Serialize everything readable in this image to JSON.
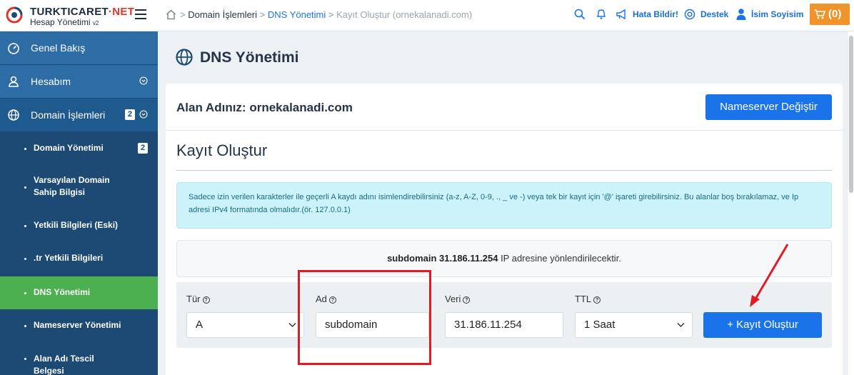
{
  "brand": {
    "name_main": "TURKTICARET",
    "name_accent": "·NET",
    "subtitle": "Hesap Yönetimi",
    "version": "v2"
  },
  "sidebar": {
    "main_items": [
      {
        "label": "Genel Bakış",
        "icon": "dashboard-icon"
      },
      {
        "label": "Hesabım",
        "icon": "user-icon"
      },
      {
        "label": "Domain İşlemleri",
        "icon": "globe-icon",
        "badge": "2"
      }
    ],
    "sub_items": [
      {
        "label": "Domain Yönetimi",
        "badge": "2"
      },
      {
        "label": "Varsayılan Domain Sahip Bilgisi"
      },
      {
        "label": "Yetkili Bilgileri (Eski)"
      },
      {
        "label": ".tr Yetkili Bilgileri"
      },
      {
        "label": "DNS Yönetimi",
        "active": true
      },
      {
        "label": "Nameserver Yönetimi"
      },
      {
        "label": "Alan Adı Tescil Belgesi"
      }
    ]
  },
  "topbar": {
    "breadcrumb": [
      "Domain İşlemleri",
      "DNS Yönetimi",
      "Kayıt Oluştur (ornekalanadi.com)"
    ],
    "report_label": "Hata Bildir!",
    "support_label": "Destek",
    "user_label": "İsim Soyisim",
    "cart_label": "(0)"
  },
  "page": {
    "title": "DNS Yönetimi",
    "domain_prefix": "Alan Adınız:",
    "domain": "ornekalanadi.com",
    "ns_button": "Nameserver Değiştir",
    "section_title": "Kayıt Oluştur",
    "info_text": "Sadece izin verilen karakterler ile geçerli A kaydı adını isimlendirebilirsiniz (a-z, A-Z, 0-9, ., _ ve -) veya tek bir kayıt için '@' işareti girebilirsiniz. Bu alanlar boş bırakılamaz, ve Ip adresi IPv4 formatında olmalıdır.(ör. 127.0.0.1)",
    "preview_bold": "subdomain 31.186.11.254",
    "preview_rest": " IP adresine yönlendirilecektir."
  },
  "form": {
    "type_label": "Tür",
    "type_value": "A",
    "name_label": "Ad",
    "name_value": "subdomain",
    "data_label": "Veri",
    "data_value": "31.186.11.254",
    "ttl_label": "TTL",
    "ttl_value": "1 Saat",
    "submit_label": "+ Kayıt Oluştur"
  },
  "colors": {
    "sidebar": "#1c4a75",
    "accent": "#1a73e8",
    "active": "#4caf50",
    "cart": "#f0932b",
    "highlight": "#e01b24"
  }
}
